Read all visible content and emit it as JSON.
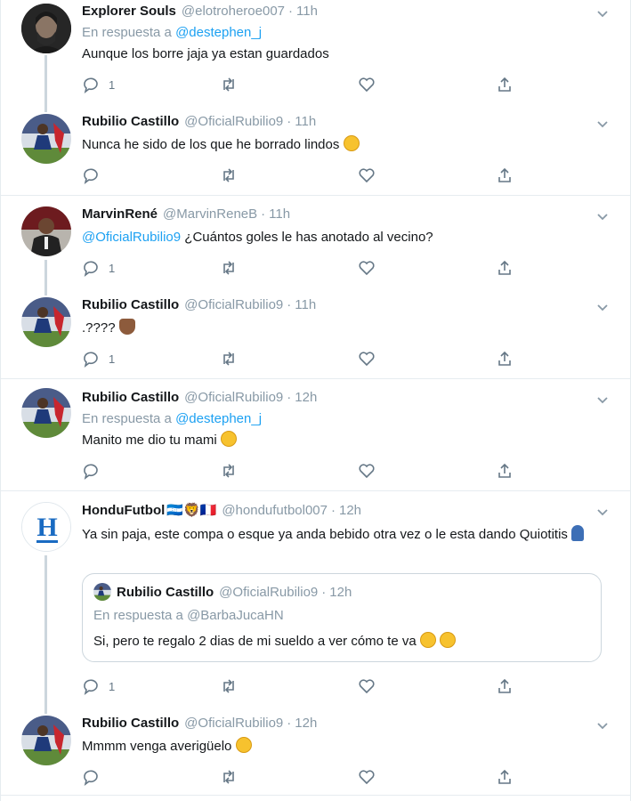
{
  "tweets": [
    {
      "name": "Explorer Souls",
      "handle": "@elotroheroe007",
      "time": "11h",
      "reply_prefix": "En respuesta a",
      "reply_mention": "@destephen_j",
      "text": "Aunque los borre jaja ya estan guardados",
      "reply_count": "1",
      "avatar": "dark-portrait-avatar"
    },
    {
      "name": "Rubilio Castillo",
      "handle": "@OficialRubilio9",
      "time": "11h",
      "text": "Nunca he sido de los que he borrado lindos",
      "emoji": "rolling-laughing-emoji",
      "reply_count": "",
      "avatar": "soccer-player-avatar"
    },
    {
      "name": "MarvinRené",
      "handle": "@MarvinReneB",
      "time": "11h",
      "text_mention": "@OficialRubilio9",
      "text": "¿Cuántos goles le has anotado al vecino?",
      "reply_count": "1",
      "avatar": "red-suit-avatar"
    },
    {
      "name": "Rubilio Castillo",
      "handle": "@OficialRubilio9",
      "time": "11h",
      "text": ".????",
      "emoji": "person-shrugging-emoji",
      "reply_count": "1",
      "avatar": "soccer-player-avatar"
    },
    {
      "name": "Rubilio Castillo",
      "handle": "@OficialRubilio9",
      "time": "12h",
      "reply_prefix": "En respuesta a",
      "reply_mention": "@destephen_j",
      "text": "Manito me dio tu mami",
      "emoji": "hand-over-mouth-emoji",
      "reply_count": "",
      "avatar": "soccer-player-avatar"
    },
    {
      "name": "HonduFutbol",
      "name_emojis": "🇭🇳🦁🇫🇷",
      "handle": "@hondufutbol007",
      "time": "12h",
      "text": "Ya sin paja, este compa o esque ya anda bebido otra vez o le esta dando Quiotitis",
      "emoji": "person-standing-emoji",
      "reply_count": "1",
      "avatar": "h-logo-avatar",
      "avatar_letter": "H",
      "quote": {
        "name": "Rubilio Castillo",
        "handle": "@OficialRubilio9",
        "time": "12h",
        "reply_prefix": "En respuesta a",
        "reply_mention": "@BarbaJucaHN",
        "text": "Si, pero te regalo 2 dias de mi sueldo a ver cómo te va"
      }
    },
    {
      "name": "Rubilio Castillo",
      "handle": "@OficialRubilio9",
      "time": "12h",
      "text": "Mmmm venga averigüelo",
      "emoji": "winking-tongue-emoji",
      "reply_count": "",
      "avatar": "soccer-player-avatar"
    }
  ],
  "separator": "·",
  "colors": {
    "link": "#1da1f2",
    "muted": "#8899a6",
    "line": "#ccd6dd",
    "text": "#14171a"
  }
}
